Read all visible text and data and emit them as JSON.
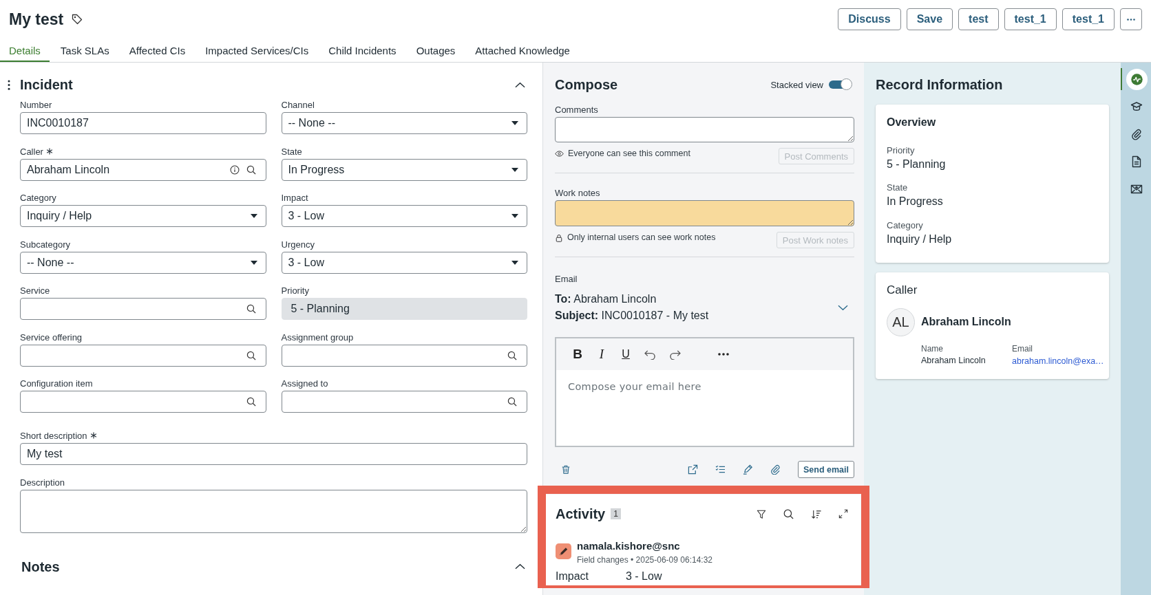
{
  "header": {
    "title": "My test",
    "actions": [
      {
        "label": "Discuss"
      },
      {
        "label": "Save"
      },
      {
        "label": "test"
      },
      {
        "label": "test_1"
      },
      {
        "label": "test_1"
      }
    ]
  },
  "tabs": [
    {
      "label": "Details",
      "selected": true
    },
    {
      "label": "Task SLAs",
      "selected": false
    },
    {
      "label": "Affected CIs",
      "selected": false
    },
    {
      "label": "Impacted Services/CIs",
      "selected": false
    },
    {
      "label": "Child Incidents",
      "selected": false
    },
    {
      "label": "Outages",
      "selected": false
    },
    {
      "label": "Attached Knowledge",
      "selected": false
    }
  ],
  "incident_form": {
    "title": "Incident",
    "expanded": true,
    "fields": [
      {
        "label": "Number",
        "required": false,
        "kind": "text",
        "value": "INC0010187"
      },
      {
        "label": "Channel",
        "required": false,
        "kind": "select",
        "value": "-- None --"
      },
      {
        "label": "Caller",
        "required": true,
        "kind": "reference",
        "value": "Abraham Lincoln"
      },
      {
        "label": "State",
        "required": false,
        "kind": "select",
        "value": "In Progress"
      },
      {
        "label": "Category",
        "required": false,
        "kind": "select",
        "value": "Inquiry / Help"
      },
      {
        "label": "Impact",
        "required": false,
        "kind": "select",
        "value": "3 - Low"
      },
      {
        "label": "Subcategory",
        "required": false,
        "kind": "select",
        "value": "-- None --"
      },
      {
        "label": "Urgency",
        "required": false,
        "kind": "select",
        "value": "3 - Low"
      },
      {
        "label": "Service",
        "required": false,
        "kind": "reference"
      },
      {
        "label": "Priority",
        "required": false,
        "kind": "readonly",
        "value": "5 - Planning"
      },
      {
        "label": "Service offering",
        "required": false,
        "kind": "reference"
      },
      {
        "label": "Assignment group",
        "required": false,
        "kind": "reference"
      },
      {
        "label": "Configuration item",
        "required": false,
        "kind": "reference"
      },
      {
        "label": "Assigned to",
        "required": false,
        "kind": "reference"
      }
    ],
    "wide_fields": [
      {
        "label": "Short description",
        "required": true,
        "kind": "text",
        "value": "My test"
      },
      {
        "label": "Description",
        "required": false,
        "kind": "textarea"
      }
    ]
  },
  "notes_section": {
    "title": "Notes",
    "expanded": true
  },
  "compose": {
    "title": "Compose",
    "stacked_view": {
      "label": "Stacked view",
      "on": true
    },
    "comments": {
      "label": "Comments",
      "hint": "Everyone can see this comment",
      "button": "Post Comments",
      "button_disabled": true
    },
    "work_notes": {
      "label": "Work notes",
      "hint": "Only internal users can see work notes",
      "button": "Post Work notes",
      "button_disabled": true
    },
    "email": {
      "label": "Email",
      "to": "**To:** Abraham Lincoln",
      "subject": "**Subject:** INC0010187 - My test",
      "expanded": false,
      "format_buttons": [
        {
          "label": "B",
          "kind": "bold"
        },
        {
          "label": "I",
          "kind": "italic"
        },
        {
          "label": "U",
          "kind": "underline"
        }
      ],
      "placeholder": "Compose your email here",
      "send_button": "Send email"
    }
  },
  "activity": {
    "title": "Activity",
    "count": "1",
    "highlighted": true,
    "entries": [
      {
        "author": "namala.kishore@snc",
        "meta": "Field changes • 2025-06-09 06:14:32",
        "changes": [
          {
            "field": "Impact",
            "value": "3 - Low"
          }
        ]
      }
    ]
  },
  "record_information": {
    "title": "Record Information",
    "overview": {
      "title": "Overview",
      "items": [
        {
          "label": "Priority",
          "value": "5 - Planning"
        },
        {
          "label": "State",
          "value": "In Progress"
        },
        {
          "label": "Category",
          "value": "Inquiry / Help"
        }
      ]
    },
    "caller": {
      "title": "Caller",
      "initials": "AL",
      "name": "Abraham Lincoln",
      "details": [
        {
          "label": "Name",
          "value": "Abraham Lincoln",
          "kind": "text"
        },
        {
          "label": "Email",
          "value": "abraham.lincoln@exa…",
          "kind": "link"
        }
      ]
    }
  },
  "side_rail": [
    {
      "kind": "activity",
      "selected": true
    },
    {
      "kind": "learning",
      "selected": false
    },
    {
      "kind": "attachments",
      "selected": false
    },
    {
      "kind": "document",
      "selected": false
    },
    {
      "kind": "email",
      "selected": false
    }
  ]
}
